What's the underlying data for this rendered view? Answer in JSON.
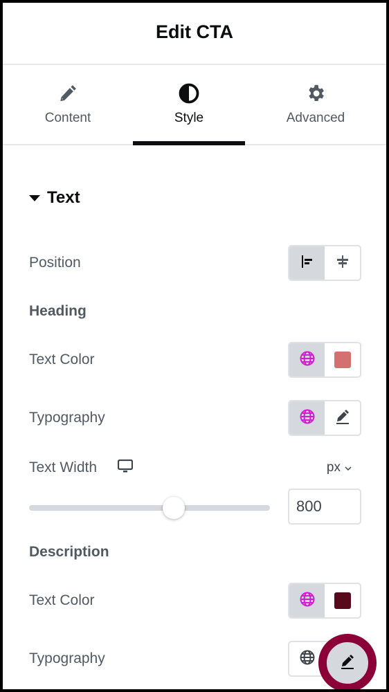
{
  "header": {
    "title": "Edit CTA"
  },
  "tabs": [
    {
      "label": "Content",
      "icon": "pencil-icon",
      "active": false
    },
    {
      "label": "Style",
      "icon": "half-circle-icon",
      "active": true
    },
    {
      "label": "Advanced",
      "icon": "gear-icon",
      "active": false
    }
  ],
  "section": {
    "title": "Text",
    "expanded": true
  },
  "position": {
    "label": "Position",
    "options": [
      {
        "name": "align-start",
        "selected": true
      },
      {
        "name": "align-center",
        "selected": false
      }
    ]
  },
  "heading": {
    "label": "Heading",
    "text_color": {
      "label": "Text Color",
      "global_active": true,
      "color": "#d37070"
    },
    "typography": {
      "label": "Typography",
      "global_active": true
    },
    "text_width": {
      "label": "Text Width",
      "device": "desktop",
      "unit": "px",
      "value": "800",
      "slider_fraction": 0.6
    }
  },
  "description": {
    "label": "Description",
    "text_color": {
      "label": "Text Color",
      "global_active": true,
      "color": "#560a1c"
    },
    "typography": {
      "label": "Typography",
      "global_active": false,
      "highlighted": "edit-typography"
    }
  },
  "colors": {
    "global_icon": "#d11cd1",
    "highlight_ring": "#8a0037",
    "accent": "#0c0d0e"
  }
}
